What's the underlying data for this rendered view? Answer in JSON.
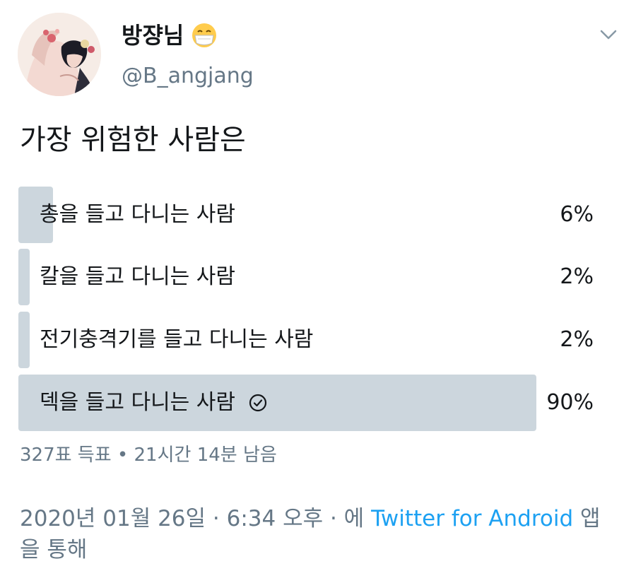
{
  "author": {
    "display_name": "방쟝님",
    "username": "@B_angjang"
  },
  "tweet": {
    "text": "가장 위험한 사람은"
  },
  "poll": {
    "options": [
      {
        "label": "총을 들고 다니는 사람",
        "percent": "6%",
        "value": 6,
        "winner": false
      },
      {
        "label": "칼을 들고 다니는 사람",
        "percent": "2%",
        "value": 2,
        "winner": false
      },
      {
        "label": "전기충격기를 들고 다니는 사람",
        "percent": "2%",
        "value": 2,
        "winner": false
      },
      {
        "label": "덱을 들고 다니는 사람",
        "percent": "90%",
        "value": 90,
        "winner": true
      }
    ],
    "meta": "327표 득표 • 21시간 14분 남음"
  },
  "footer": {
    "timestamp": "2020년 01월 26일 · 6:34 오후 · 에 ",
    "source": "Twitter for Android",
    "suffix": "앱을 통해"
  },
  "colors": {
    "bar": "#ccd6dd",
    "muted_text": "#657786",
    "link": "#1da1f2"
  },
  "icons": {
    "emoji": "mask-face-emoji-icon",
    "menu": "chevron-down-icon",
    "winner": "check-circle-icon"
  }
}
